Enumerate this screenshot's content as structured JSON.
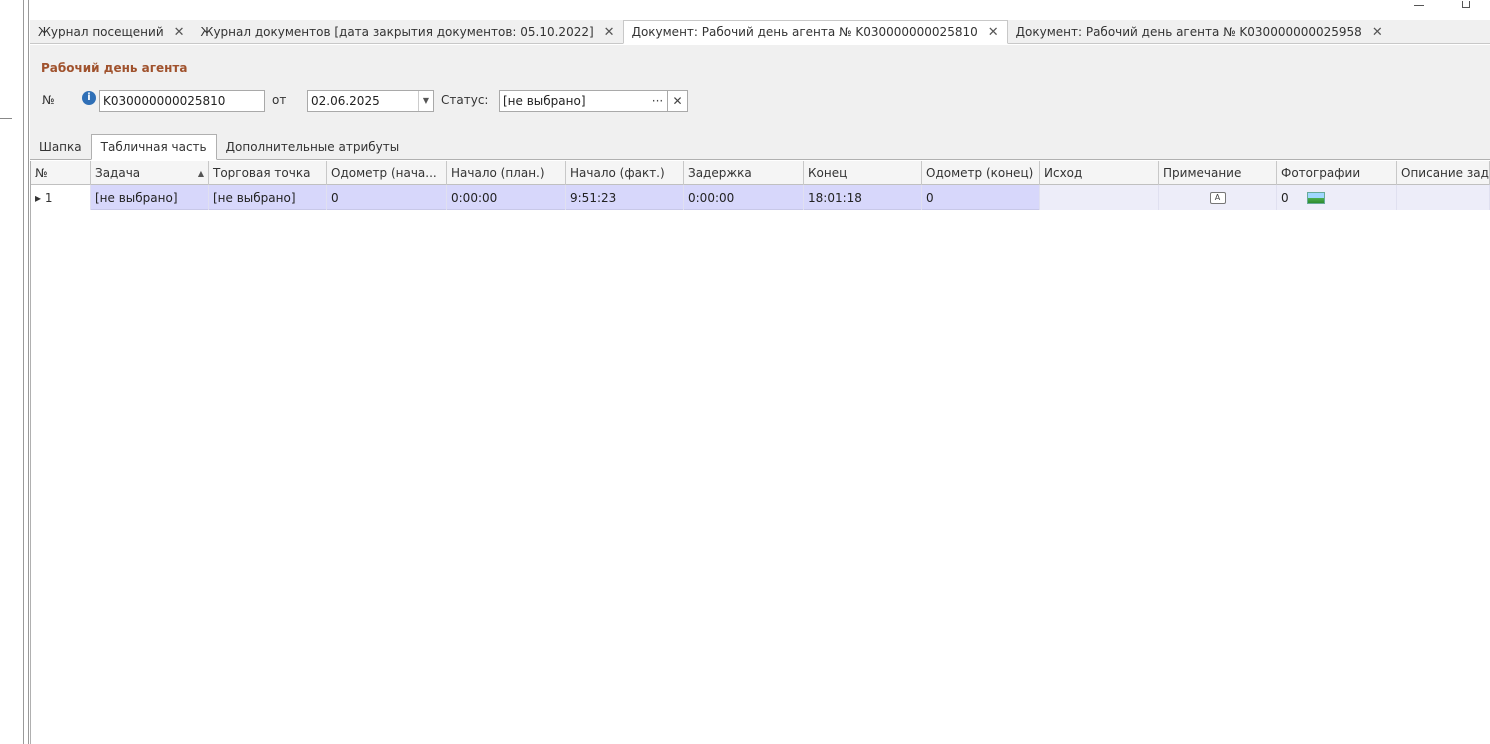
{
  "tabs": [
    {
      "label": "Журнал посещений",
      "active": false
    },
    {
      "label": "Журнал документов [дата закрытия документов: 05.10.2022]",
      "active": false
    },
    {
      "label": "Документ: Рабочий день агента № K030000000025810",
      "active": true
    },
    {
      "label": "Документ: Рабочий день агента № K030000000025958",
      "active": false
    }
  ],
  "close_glyph": "✕",
  "form": {
    "title": "Рабочий день агента",
    "number_label": "№",
    "number_value": "K030000000025810",
    "date_label": "от",
    "date_value": "02.06.2025",
    "status_label": "Статус:",
    "status_value": "[не выбрано]",
    "status_select_glyph": "···",
    "status_clear_glyph": "✕"
  },
  "section_tabs": [
    {
      "label": "Шапка",
      "active": false
    },
    {
      "label": "Табличная часть",
      "active": true
    },
    {
      "label": "Дополнительные атрибуты",
      "active": false
    }
  ],
  "grid": {
    "columns": [
      "№",
      "Задача",
      "Торговая точка",
      "Одометр (нача...",
      "Начало (план.)",
      "Начало (факт.)",
      "Задержка",
      "Конец",
      "Одометр (конец)",
      "Исход",
      "Примечание",
      "Фотографии",
      "Описание зад"
    ],
    "rows": [
      {
        "num": "▸ 1",
        "task": "[не выбрано]",
        "point": "[не выбрано]",
        "odo_start": "0",
        "plan_start": "0:00:00",
        "fact_start": "9:51:23",
        "delay": "0:00:00",
        "end": "18:01:18",
        "odo_end": "0",
        "outcome": "",
        "note_icon": "A",
        "photos": "0",
        "desc": ""
      }
    ]
  }
}
